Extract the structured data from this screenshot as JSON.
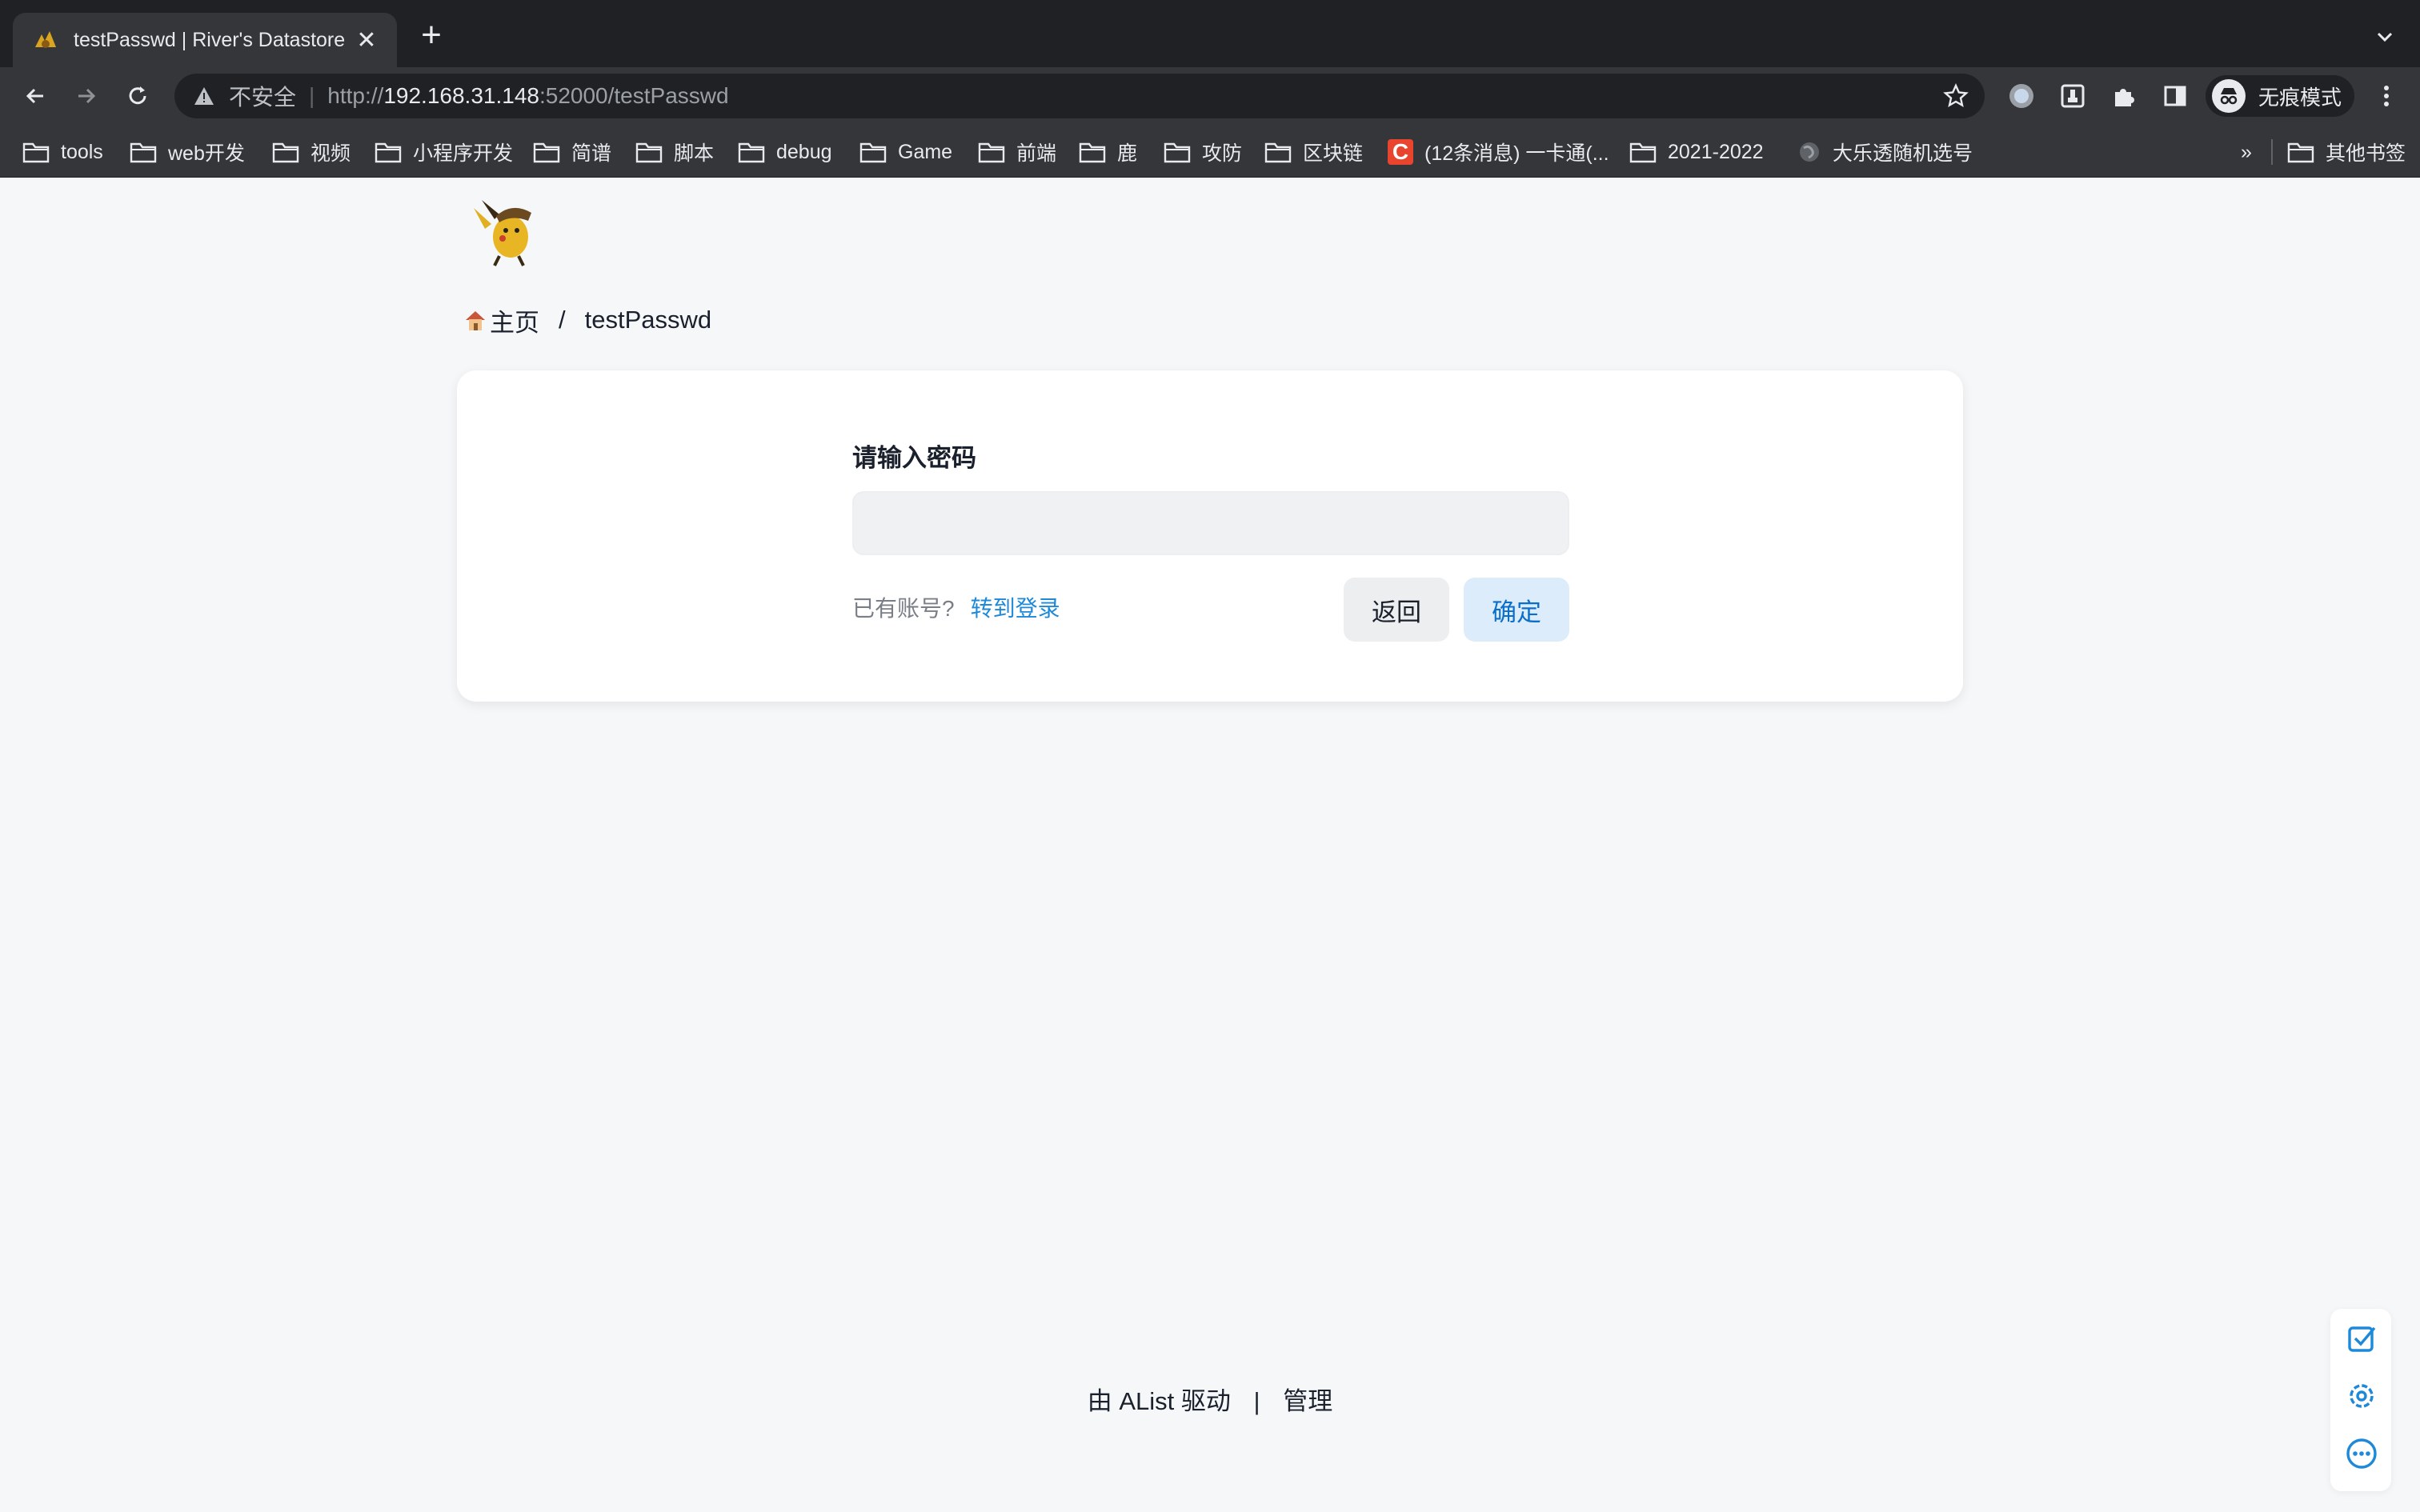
{
  "browser": {
    "tab_title": "testPasswd | River's Datastore",
    "new_tab_symbol": "+",
    "close_symbol": "✕",
    "omnibox": {
      "security_label": "不安全",
      "url_scheme": "http://",
      "url_host": "192.168.31.148",
      "url_rest": ":52000/testPasswd"
    },
    "profile_label": "无痕模式",
    "bookmarks": [
      {
        "label": "tools",
        "icon": "folder-icon"
      },
      {
        "label": "web开发",
        "icon": "folder-icon"
      },
      {
        "label": "视频",
        "icon": "folder-icon"
      },
      {
        "label": "小程序开发",
        "icon": "folder-icon"
      },
      {
        "label": "简谱",
        "icon": "folder-icon"
      },
      {
        "label": "脚本",
        "icon": "folder-icon"
      },
      {
        "label": "debug",
        "icon": "folder-icon"
      },
      {
        "label": "Game",
        "icon": "folder-icon"
      },
      {
        "label": "前端",
        "icon": "folder-icon"
      },
      {
        "label": "鹿",
        "icon": "folder-icon"
      },
      {
        "label": "攻防",
        "icon": "folder-icon"
      },
      {
        "label": "区块链",
        "icon": "folder-icon"
      },
      {
        "label": "(12条消息) 一卡通(...",
        "icon": "csdn-icon"
      },
      {
        "label": "2021-2022",
        "icon": "folder-icon"
      },
      {
        "label": "大乐透随机选号",
        "icon": "globe-icon"
      }
    ],
    "bookmarks_overflow": "»",
    "other_bookmarks": "其他书签"
  },
  "page": {
    "breadcrumb": {
      "home": "主页",
      "separator": "/",
      "current": "testPasswd"
    },
    "password_form": {
      "title": "请输入密码",
      "input_value": "",
      "input_placeholder": "",
      "has_account": "已有账号?",
      "go_login": "转到登录",
      "back_button": "返回",
      "confirm_button": "确定"
    },
    "footer": {
      "powered_by": "由 AList 驱动",
      "separator": "|",
      "manage": "管理"
    }
  },
  "colors": {
    "accent": "#1d89d8",
    "page_background": "#f6f7f9",
    "chrome_dark": "#202124",
    "chrome_toolbar": "#35363a"
  }
}
